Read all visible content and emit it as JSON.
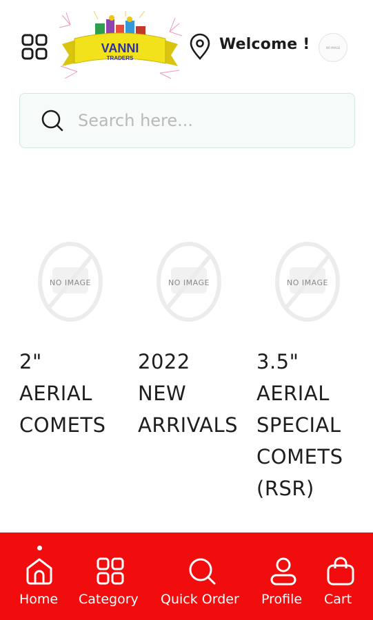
{
  "header": {
    "logo_text": "VANNI",
    "logo_subtext": "TRADERS",
    "welcome": "Welcome !",
    "avatar_text": "NO IMAGE"
  },
  "search": {
    "placeholder": "Search here..."
  },
  "categories": [
    {
      "label": "2\"\nAERIAL\nCOMETS",
      "image_text": "NO IMAGE"
    },
    {
      "label": "2022\nNEW\nARRIVALS",
      "image_text": "NO IMAGE"
    },
    {
      "label": "3.5\"\nAERIAL\nSPECIAL\nCOMETS\n(RSR)",
      "image_text": "NO IMAGE"
    }
  ],
  "bottom_nav": {
    "active": "Home",
    "items": [
      {
        "label": "Home",
        "icon": "home-icon"
      },
      {
        "label": "Category",
        "icon": "grid-icon"
      },
      {
        "label": "Quick Order",
        "icon": "search-icon"
      },
      {
        "label": "Profile",
        "icon": "user-icon"
      },
      {
        "label": "Cart",
        "icon": "bag-icon"
      }
    ]
  },
  "colors": {
    "nav_background": "#f10d0d",
    "search_border": "#cfe9df",
    "logo_banner": "#f2e21b"
  }
}
